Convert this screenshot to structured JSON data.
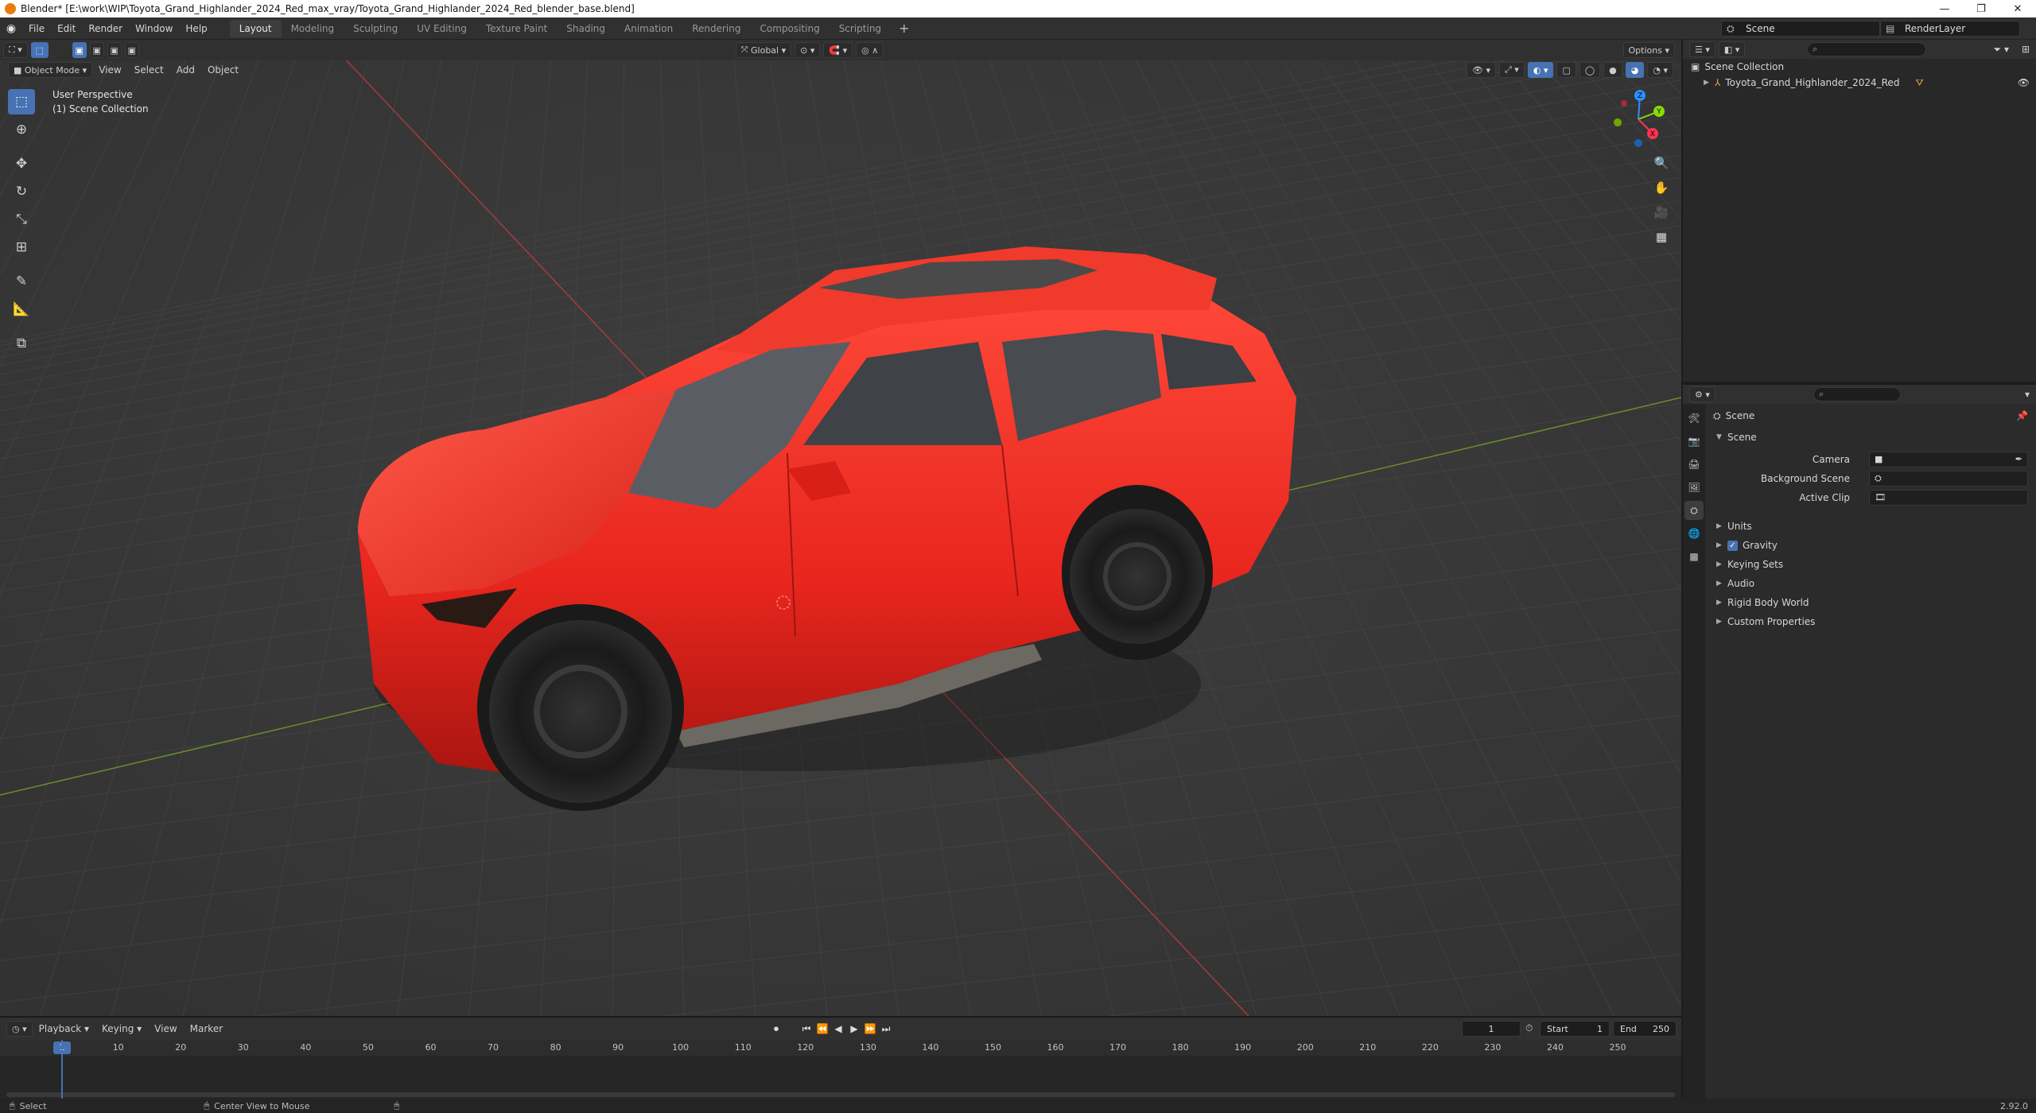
{
  "window": {
    "title": "Blender* [E:\\work\\WIP\\Toyota_Grand_Highlander_2024_Red_max_vray/Toyota_Grand_Highlander_2024_Red_blender_base.blend]",
    "minimize": "—",
    "restore": "❐",
    "close": "✕"
  },
  "menu": [
    "File",
    "Edit",
    "Render",
    "Window",
    "Help"
  ],
  "workspaces": [
    "Layout",
    "Modeling",
    "Sculpting",
    "UV Editing",
    "Texture Paint",
    "Shading",
    "Animation",
    "Rendering",
    "Compositing",
    "Scripting"
  ],
  "workspace_add": "+",
  "top_right": {
    "scene": "Scene",
    "view_layer": "RenderLayer"
  },
  "viewport": {
    "mode": "Object Mode",
    "menus": [
      "View",
      "Select",
      "Add",
      "Object"
    ],
    "transform_orientation": "Global",
    "options_label": "Options",
    "info_line1": "User Perspective",
    "info_line2": "(1) Scene Collection",
    "gizmo": {
      "x": "X",
      "y": "Y",
      "z": "Z"
    }
  },
  "timeline": {
    "menus": [
      "Playback",
      "Keying",
      "View",
      "Marker"
    ],
    "current_frame": "1",
    "start_label": "Start",
    "start": "1",
    "end_label": "End",
    "end": "250",
    "ruler": [
      "1",
      "10",
      "20",
      "30",
      "40",
      "50",
      "60",
      "70",
      "80",
      "90",
      "100",
      "110",
      "120",
      "130",
      "140",
      "150",
      "160",
      "170",
      "180",
      "190",
      "200",
      "210",
      "220",
      "230",
      "240",
      "250"
    ]
  },
  "status": {
    "select": "Select",
    "center_view": "Center View to Mouse",
    "version": "2.92.0"
  },
  "outliner": {
    "root": "Scene Collection",
    "object": "Toyota_Grand_Highlander_2024_Red"
  },
  "properties": {
    "header": "Scene",
    "panel": "Scene",
    "camera_label": "Camera",
    "background_label": "Background Scene",
    "clip_label": "Active Clip",
    "sections": [
      "Units",
      "Gravity",
      "Keying Sets",
      "Audio",
      "Rigid Body World",
      "Custom Properties"
    ]
  },
  "colors": {
    "accent": "#4772b3",
    "car_body": "#e8261e",
    "x_axis": "#ff3352",
    "y_axis": "#8bdc00",
    "z_axis": "#2890ff"
  }
}
